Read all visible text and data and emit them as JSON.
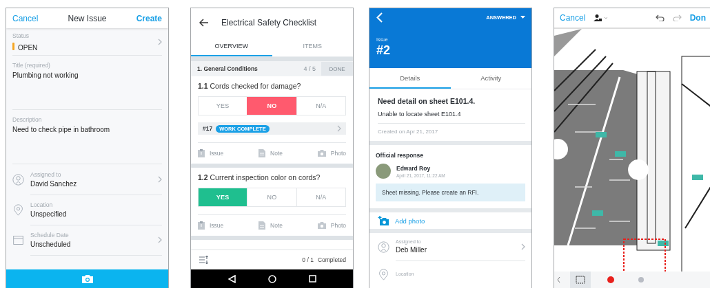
{
  "new_issue_screen": {
    "header": {
      "cancel": "Cancel",
      "title": "New Issue",
      "create": "Create"
    },
    "status": {
      "label": "Status",
      "value": "OPEN",
      "color": "#f5a623"
    },
    "title_field": {
      "label": "Title (required)",
      "value": "Plumbing not working"
    },
    "description_field": {
      "label": "Description",
      "value": "Need to check pipe in bathroom"
    },
    "fields": [
      {
        "kind": "person",
        "label": "Assigned to",
        "value": "David Sanchez",
        "chevron": true
      },
      {
        "kind": "location",
        "label": "Location",
        "value": "Unspecified",
        "chevron": false
      },
      {
        "kind": "calendar",
        "label": "Schedule Date",
        "value": "Unscheduled",
        "chevron": true
      }
    ]
  },
  "checklist_screen": {
    "title": "Electrical Safety Checklist",
    "tabs": [
      {
        "label": "OVERVIEW",
        "selected": true
      },
      {
        "label": "ITEMS",
        "selected": false
      }
    ],
    "section": {
      "title": "1. General Conditions",
      "count": "4 / 5",
      "done": "DONE",
      "disabled": true
    },
    "questions": [
      {
        "number": "1.1",
        "text": "Cords checked for damage?",
        "options": [
          {
            "kind": "yes",
            "label": "YES",
            "selected": false
          },
          {
            "kind": "no",
            "label": "NO",
            "selected": true
          },
          {
            "kind": "na",
            "label": "N/A",
            "selected": false
          }
        ],
        "linked_issue": {
          "number": "#17",
          "badge": "WORK COMPLETE"
        },
        "actions": [
          {
            "kind": "issue",
            "label": "Issue"
          },
          {
            "kind": "note",
            "label": "Note"
          },
          {
            "kind": "photo",
            "label": "Photo"
          }
        ]
      },
      {
        "number": "1.2",
        "text": "Current inspection color on cords?",
        "options": [
          {
            "kind": "yes",
            "label": "YES",
            "selected": true
          },
          {
            "kind": "no",
            "label": "NO",
            "selected": false
          },
          {
            "kind": "na",
            "label": "N/A",
            "selected": false
          }
        ],
        "actions": [
          {
            "kind": "issue",
            "label": "Issue"
          },
          {
            "kind": "note",
            "label": "Note"
          },
          {
            "kind": "photo",
            "label": "Photo"
          }
        ]
      }
    ],
    "footer": {
      "progress": "0 / 1",
      "label": "Completed"
    }
  },
  "issue_detail_screen": {
    "status": "ANSWERED",
    "label": "Issue",
    "number": "#2",
    "tabs": [
      {
        "label": "Details",
        "selected": true
      },
      {
        "label": "Activity",
        "selected": false
      }
    ],
    "title": "Need detail on sheet E101.4.",
    "description": "Unable to locate sheet E101.4",
    "created": "Created on Apr 21, 2017",
    "response": {
      "heading": "Official response",
      "author": "Edward Roy",
      "time": "April 21, 2017, 11:22 AM",
      "message": "Sheet missing. Please create an RFI."
    },
    "add_photo": "Add photo",
    "fields": [
      {
        "kind": "person",
        "label": "Assigned to",
        "value": "Deb Miller",
        "chevron": true
      },
      {
        "kind": "location",
        "label": "Location",
        "chevron": false
      }
    ]
  },
  "markup_screen": {
    "cancel": "Cancel",
    "done": "Don",
    "tools": [
      {
        "kind": "cloud",
        "selected": true
      },
      {
        "kind": "color",
        "color": "#e8201c",
        "selected": false
      },
      {
        "kind": "stroke",
        "color": "#b8bcc4",
        "selected": false
      }
    ]
  }
}
